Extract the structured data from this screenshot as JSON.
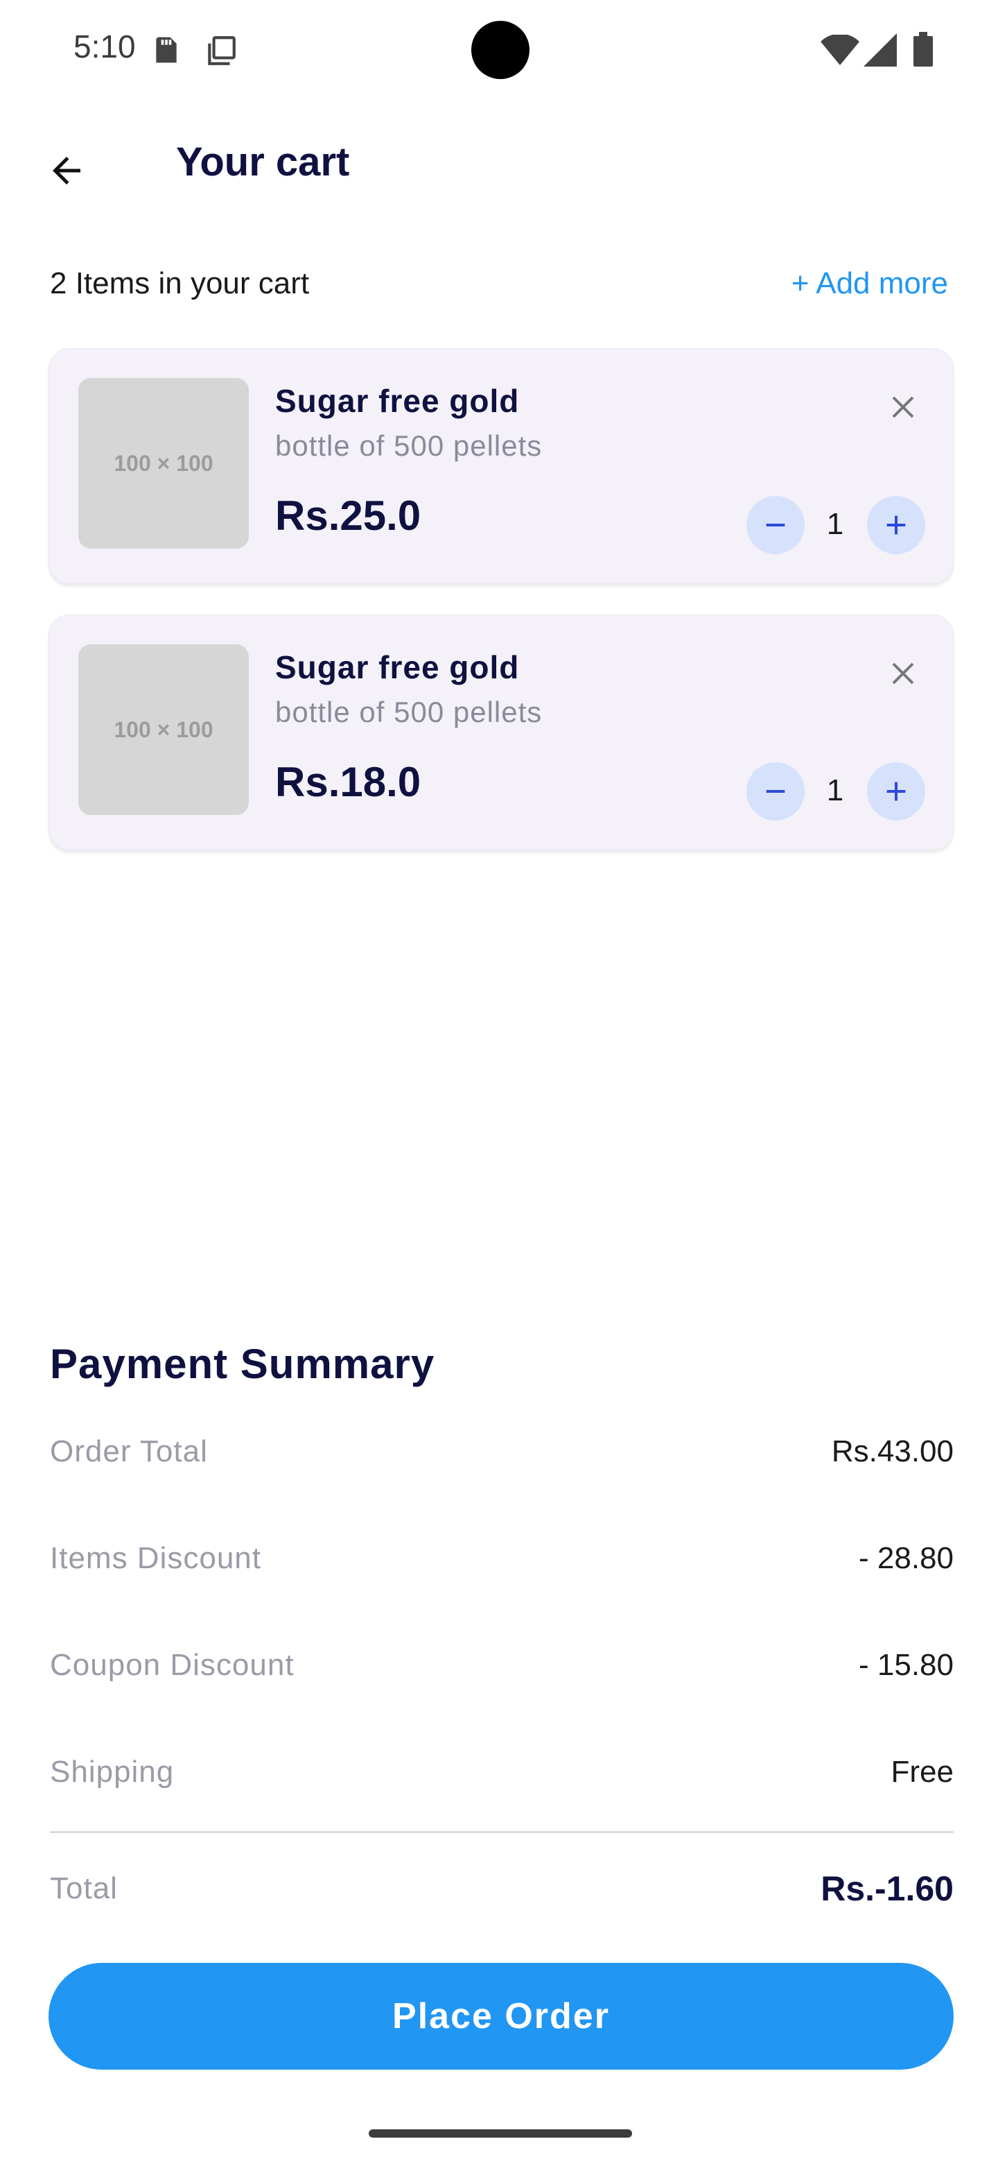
{
  "status_bar": {
    "time": "5:10"
  },
  "header": {
    "title": "Your cart"
  },
  "cart_summary": {
    "count_text": "2 Items in your cart",
    "add_more_label": "+ Add more"
  },
  "cart_items": [
    {
      "image_placeholder": "100 × 100",
      "name": "Sugar free gold",
      "description": "bottle of 500 pellets",
      "price": "Rs.25.0",
      "quantity": "1"
    },
    {
      "image_placeholder": "100 × 100",
      "name": "Sugar free gold",
      "description": "bottle of 500 pellets",
      "price": "Rs.18.0",
      "quantity": "1"
    }
  ],
  "payment_summary": {
    "title": "Payment Summary",
    "rows": [
      {
        "label": "Order Total",
        "value": "Rs.43.00"
      },
      {
        "label": "Items Discount",
        "value": "- 28.80"
      },
      {
        "label": "Coupon Discount",
        "value": "- 15.80"
      },
      {
        "label": "Shipping",
        "value": "Free"
      }
    ],
    "total": {
      "label": "Total",
      "value": "Rs.-1.60"
    }
  },
  "actions": {
    "place_order_label": "Place Order"
  },
  "colors": {
    "accent": "#2196f3",
    "card_bg": "#f4f1f8",
    "qty_button_bg": "#d6e1fb",
    "title_text": "#0f1140"
  }
}
